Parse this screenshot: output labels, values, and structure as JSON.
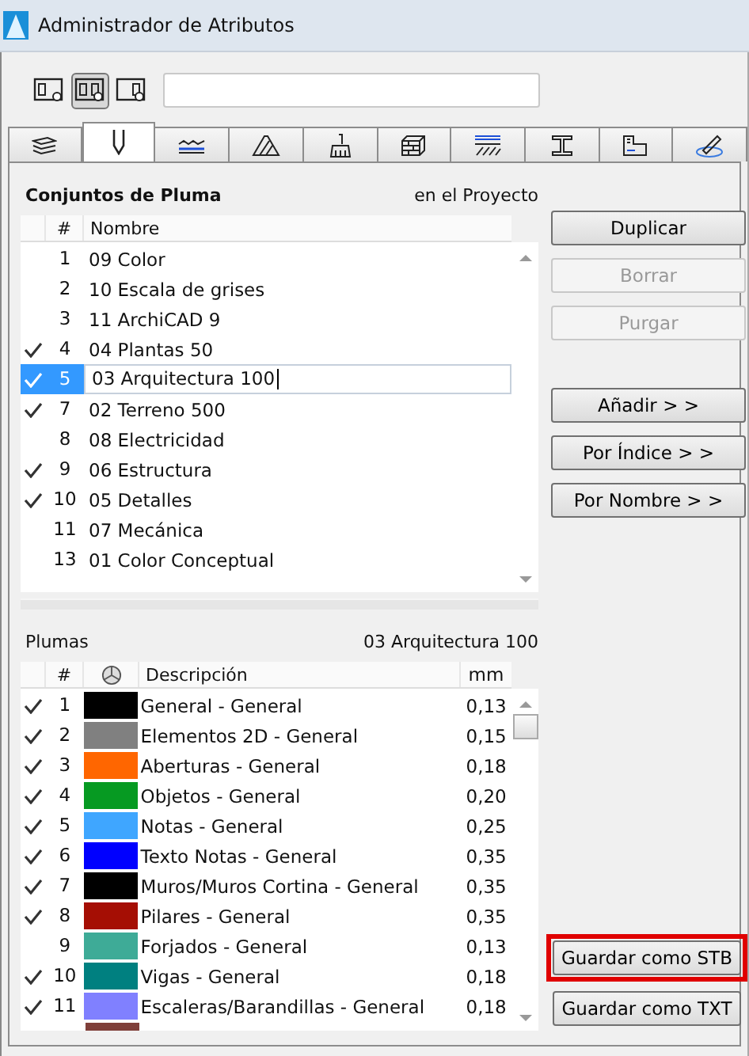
{
  "window": {
    "title": "Administrador de Atributos"
  },
  "view_buttons": [
    {
      "selected": false
    },
    {
      "selected": true
    },
    {
      "selected": false
    }
  ],
  "tabs": [
    {
      "kind": "layers",
      "selected": false
    },
    {
      "kind": "pen",
      "selected": true
    },
    {
      "kind": "line",
      "selected": false
    },
    {
      "kind": "fill",
      "selected": false
    },
    {
      "kind": "brush",
      "selected": false
    },
    {
      "kind": "composite",
      "selected": false
    },
    {
      "kind": "surface",
      "selected": false
    },
    {
      "kind": "profile",
      "selected": false
    },
    {
      "kind": "zone",
      "selected": false
    },
    {
      "kind": "markup",
      "selected": false
    }
  ],
  "pen_sets": {
    "title": "Conjuntos de Pluma",
    "scope": "en el Proyecto",
    "columns": [
      "#",
      "Nombre"
    ],
    "rows": [
      {
        "index": "1",
        "name": "09 Color",
        "checked": false,
        "selected": false
      },
      {
        "index": "2",
        "name": "10 Escala de grises",
        "checked": false,
        "selected": false
      },
      {
        "index": "3",
        "name": "11 ArchiCAD 9",
        "checked": false,
        "selected": false
      },
      {
        "index": "4",
        "name": "04 Plantas 50",
        "checked": true,
        "selected": false
      },
      {
        "index": "5",
        "name": "03 Arquitectura 100",
        "checked": true,
        "selected": true
      },
      {
        "index": "7",
        "name": "02 Terreno 500",
        "checked": true,
        "selected": false
      },
      {
        "index": "8",
        "name": "08 Electricidad",
        "checked": false,
        "selected": false
      },
      {
        "index": "9",
        "name": "06 Estructura",
        "checked": true,
        "selected": false
      },
      {
        "index": "10",
        "name": "05 Detalles",
        "checked": true,
        "selected": false
      },
      {
        "index": "11",
        "name": "07 Mecánica",
        "checked": false,
        "selected": false
      },
      {
        "index": "13",
        "name": "01 Color Conceptual",
        "checked": false,
        "selected": false
      }
    ]
  },
  "pens": {
    "title": "Plumas",
    "set_name": "03 Arquitectura 100",
    "columns": [
      "#",
      "Descripción",
      "mm"
    ],
    "rows": [
      {
        "index": "1",
        "color": "#000000",
        "description": "General - General",
        "mm": "0,13",
        "checked": true
      },
      {
        "index": "2",
        "color": "#808080",
        "description": "Elementos 2D - General",
        "mm": "0,15",
        "checked": true
      },
      {
        "index": "3",
        "color": "#ff6600",
        "description": "Aberturas - General",
        "mm": "0,18",
        "checked": true
      },
      {
        "index": "4",
        "color": "#069a22",
        "description": "Objetos - General",
        "mm": "0,20",
        "checked": true
      },
      {
        "index": "5",
        "color": "#3fa6ff",
        "description": "Notas - General",
        "mm": "0,25",
        "checked": true
      },
      {
        "index": "6",
        "color": "#0000ff",
        "description": "Texto Notas - General",
        "mm": "0,35",
        "checked": true
      },
      {
        "index": "7",
        "color": "#000000",
        "description": "Muros/Muros Cortina - General",
        "mm": "0,35",
        "checked": true
      },
      {
        "index": "8",
        "color": "#a50e04",
        "description": "Pilares - General",
        "mm": "0,35",
        "checked": true
      },
      {
        "index": "9",
        "color": "#3eab97",
        "description": "Forjados - General",
        "mm": "0,13",
        "checked": false
      },
      {
        "index": "10",
        "color": "#008080",
        "description": "Vigas - General",
        "mm": "0,18",
        "checked": true
      },
      {
        "index": "11",
        "color": "#8080ff",
        "description": "Escaleras/Barandillas - General",
        "mm": "0,18",
        "checked": true
      },
      {
        "color": "#7f3f3a"
      }
    ]
  },
  "buttons_top": [
    {
      "label": "Duplicar",
      "disabled": false
    },
    {
      "label": "Borrar",
      "disabled": true
    },
    {
      "label": "Purgar",
      "disabled": true
    }
  ],
  "buttons_mid": [
    {
      "label": "Añadir > >",
      "disabled": false
    },
    {
      "label": "Por Índice > >",
      "disabled": false
    },
    {
      "label": "Por Nombre > >",
      "disabled": false
    }
  ],
  "buttons_bottom": [
    {
      "label": "Guardar como STB",
      "highlighted": true
    },
    {
      "label": "Guardar como TXT",
      "highlighted": false
    }
  ]
}
